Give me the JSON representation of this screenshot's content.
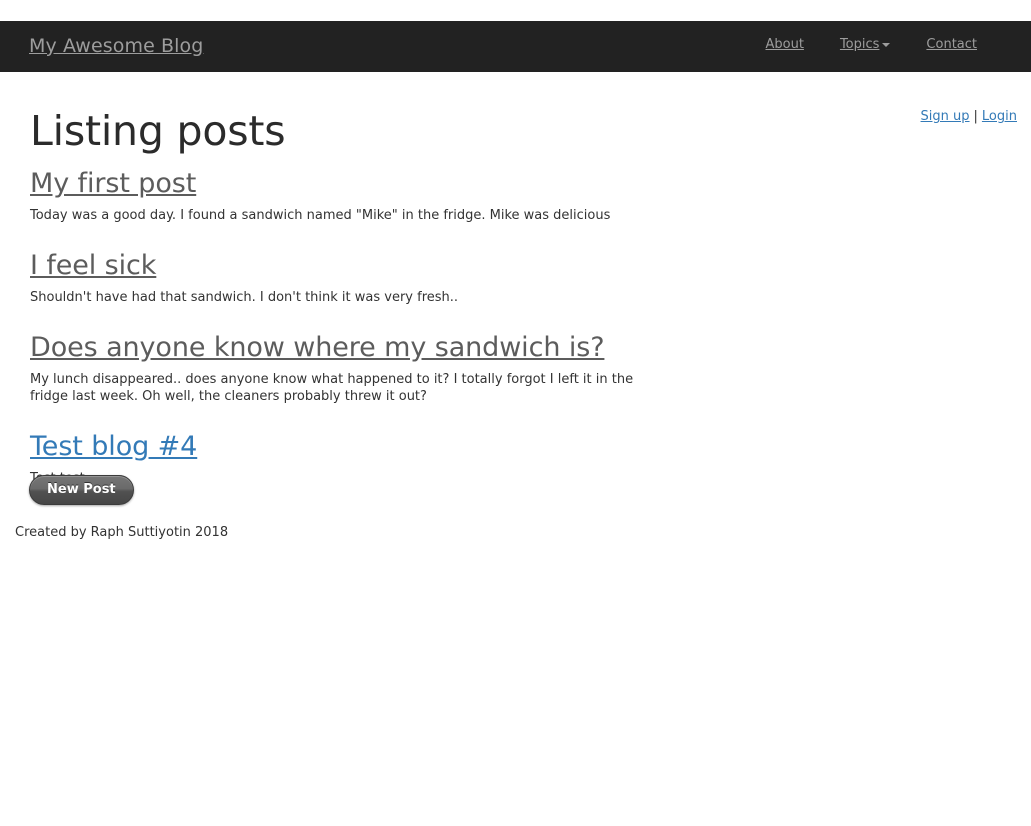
{
  "navbar": {
    "brand": "My Awesome Blog",
    "links": [
      {
        "label": "About",
        "name": "nav-link-about",
        "type": "link"
      },
      {
        "label": "Topics",
        "name": "nav-link-topics",
        "type": "dropdown",
        "caret_icon": "chevron-down-icon"
      },
      {
        "label": "Contact",
        "name": "nav-link-contact",
        "type": "link"
      }
    ],
    "background_color": "#222222",
    "link_color": "#9d9d9d"
  },
  "auth": {
    "signup_label": "Sign up",
    "separator": "|",
    "login_label": "Login",
    "link_color": "#337ab7"
  },
  "page": {
    "title": "Listing posts"
  },
  "posts": [
    {
      "title": "My first post",
      "body": "Today was a good day. I found a sandwich named \"Mike\" in the fridge. Mike was delicious",
      "link_state": "visited",
      "title_color": "#5c5c5c"
    },
    {
      "title": "I feel sick",
      "body": "Shouldn't have had that sandwich. I don't think it was very fresh..",
      "link_state": "visited",
      "title_color": "#5c5c5c"
    },
    {
      "title": "Does anyone know where my sandwich is?",
      "body": "My lunch disappeared.. does anyone know what happened to it? I totally forgot I left it in the fridge last week. Oh well, the cleaners probably threw it out?",
      "link_state": "visited",
      "title_color": "#5c5c5c"
    },
    {
      "title": "Test blog #4",
      "body": "Test test",
      "link_state": "unvisited",
      "title_color": "#337ab7"
    }
  ],
  "actions": {
    "new_post_label": "New Post"
  },
  "footer": {
    "credit": "Created by Raph Suttiyotin 2018"
  }
}
